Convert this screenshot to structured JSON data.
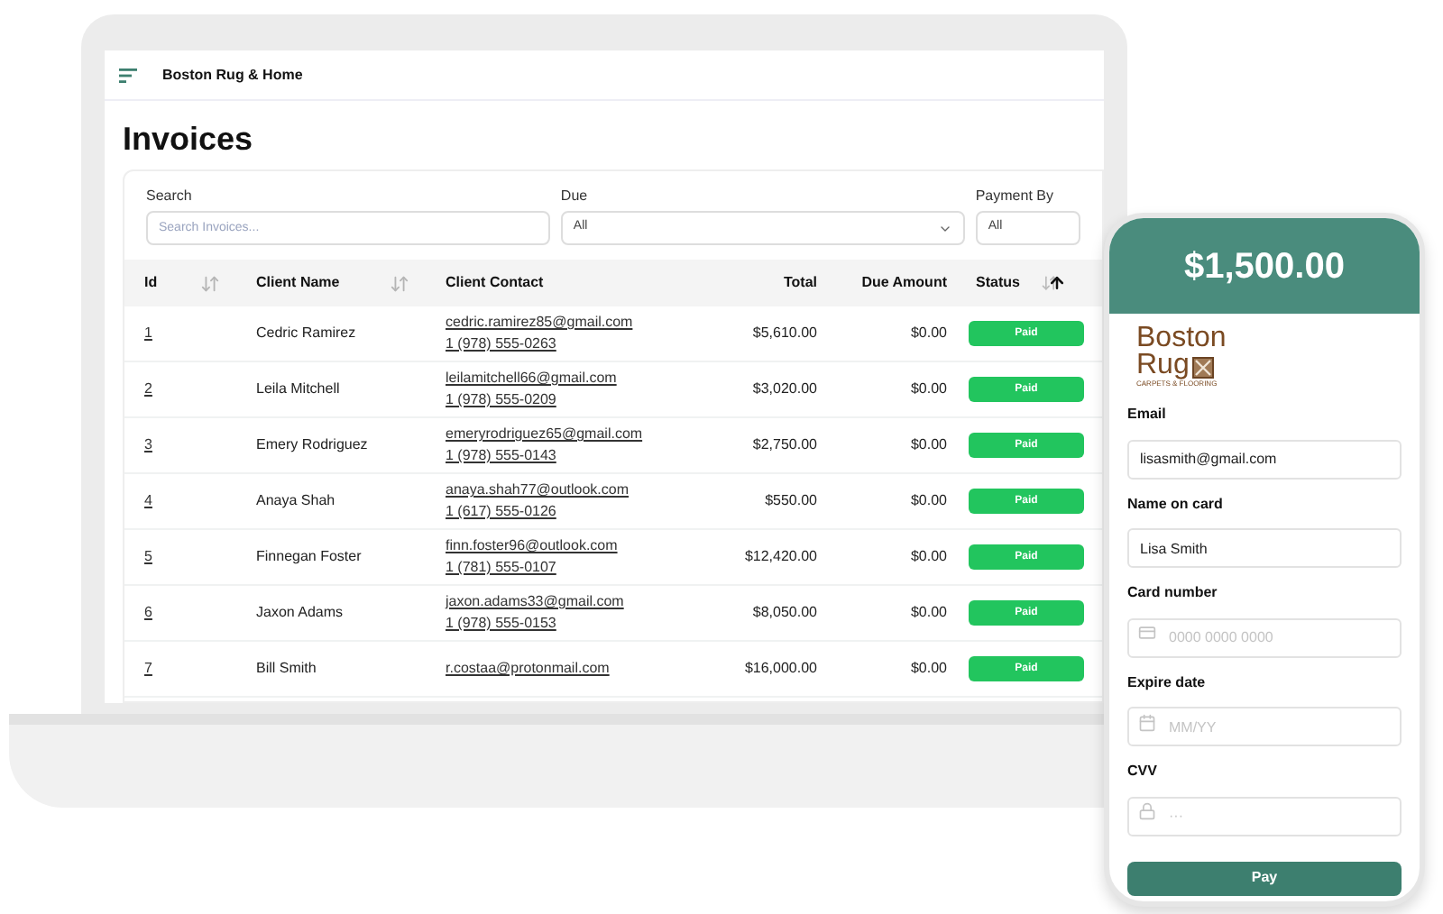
{
  "app": {
    "title": "Boston Rug & Home"
  },
  "page": {
    "title": "Invoices"
  },
  "filters": [
    {
      "kind": "search",
      "label": "Search",
      "placeholder": "Search Invoices..."
    },
    {
      "kind": "select",
      "label": "Due",
      "value": "All"
    },
    {
      "kind": "select",
      "label": "Payment By",
      "value": "All"
    }
  ],
  "table": {
    "columns": [
      {
        "label": "Id",
        "sortable": true,
        "sorted": false
      },
      {
        "label": "Client Name",
        "sortable": true,
        "sorted": false
      },
      {
        "label": "Client Contact",
        "sortable": false
      },
      {
        "label": "Total",
        "sortable": false
      },
      {
        "label": "Due Amount",
        "sortable": false
      },
      {
        "label": "Status",
        "sortable": true,
        "sorted": true
      }
    ],
    "rows": [
      {
        "id": "1",
        "name": "Cedric Ramirez",
        "email": "cedric.ramirez85@gmail.com",
        "phone": "1 (978) 555-0263",
        "total": "$5,610.00",
        "due": "$0.00",
        "status": "Paid"
      },
      {
        "id": "2",
        "name": "Leila Mitchell",
        "email": "leilamitchell66@gmail.com",
        "phone": "1 (978) 555-0209",
        "total": "$3,020.00",
        "due": "$0.00",
        "status": "Paid"
      },
      {
        "id": "3",
        "name": "Emery Rodriguez",
        "email": "emeryrodriguez65@gmail.com",
        "phone": "1 (978) 555-0143",
        "total": "$2,750.00",
        "due": "$0.00",
        "status": "Paid"
      },
      {
        "id": "4",
        "name": "Anaya Shah",
        "email": "anaya.shah77@outlook.com",
        "phone": "1 (617) 555-0126",
        "total": "$550.00",
        "due": "$0.00",
        "status": "Paid"
      },
      {
        "id": "5",
        "name": "Finnegan Foster",
        "email": "finn.foster96@outlook.com",
        "phone": "1 (781) 555-0107",
        "total": "$12,420.00",
        "due": "$0.00",
        "status": "Paid"
      },
      {
        "id": "6",
        "name": "Jaxon Adams",
        "email": "jaxon.adams33@gmail.com",
        "phone": "1 (978) 555-0153",
        "total": "$8,050.00",
        "due": "$0.00",
        "status": "Paid"
      },
      {
        "id": "7",
        "name": "Bill Smith",
        "email": "r.costaa@protonmail.com",
        "total": "$16,000.00",
        "due": "$0.00",
        "status": "Paid"
      }
    ]
  },
  "payment": {
    "amount": "$1,500.00",
    "logo": {
      "line_1": "Boston",
      "line_2": "Rug",
      "tagline": "CARPETS & FLOORING"
    },
    "fields": [
      {
        "label": "Email",
        "value": "lisasmith@gmail.com"
      },
      {
        "label": "Name on card",
        "value": "Lisa Smith"
      },
      {
        "label": "Card number",
        "placeholder": "0000 0000 0000"
      },
      {
        "label": "Expire date",
        "placeholder": "MM/YY"
      },
      {
        "label": "CVV",
        "placeholder": "···"
      }
    ],
    "button": "Pay"
  }
}
